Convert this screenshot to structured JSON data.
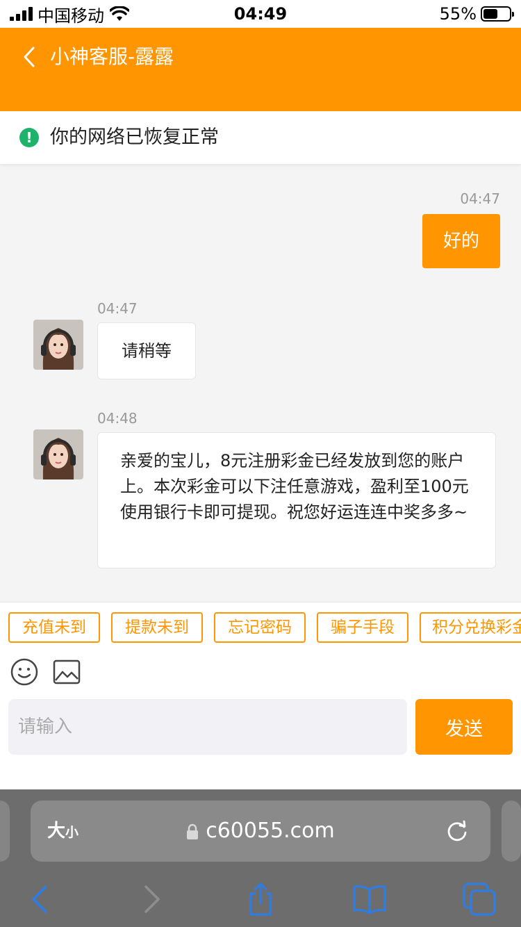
{
  "status_bar": {
    "carrier": "中国移动",
    "time": "04:49",
    "battery": "55%",
    "battery_level": 0.55
  },
  "header": {
    "title": "小神客服-露露",
    "bg_color": "#ff9500"
  },
  "notice": {
    "text": "你的网络已恢复正常",
    "icon": "!"
  },
  "messages": [
    {
      "side": "out",
      "time": "04:47",
      "text": "好的"
    },
    {
      "side": "in",
      "time": "04:47",
      "text": "请稍等"
    },
    {
      "side": "in",
      "time": "04:48",
      "text": "亲爱的宝儿，8元注册彩金已经发放到您的账户上。本次彩金可以下注任意游戏，盈利至100元使用银行卡即可提现。祝您好运连连中奖多多~"
    }
  ],
  "quick_replies": [
    "充值未到",
    "提款未到",
    "忘记密码",
    "骗子手段",
    "积分兑换彩金"
  ],
  "toolbar": {
    "emoji_icon": "smiley-icon",
    "image_icon": "image-icon"
  },
  "input": {
    "placeholder": "请输入",
    "value": ""
  },
  "send_label": "发送",
  "browser": {
    "text_size_label_big": "大",
    "text_size_label_small": "小",
    "url": "c60055.com"
  },
  "colors": {
    "accent": "#ff9500",
    "success": "#1fb26b",
    "link_blue": "#2b7de9"
  }
}
